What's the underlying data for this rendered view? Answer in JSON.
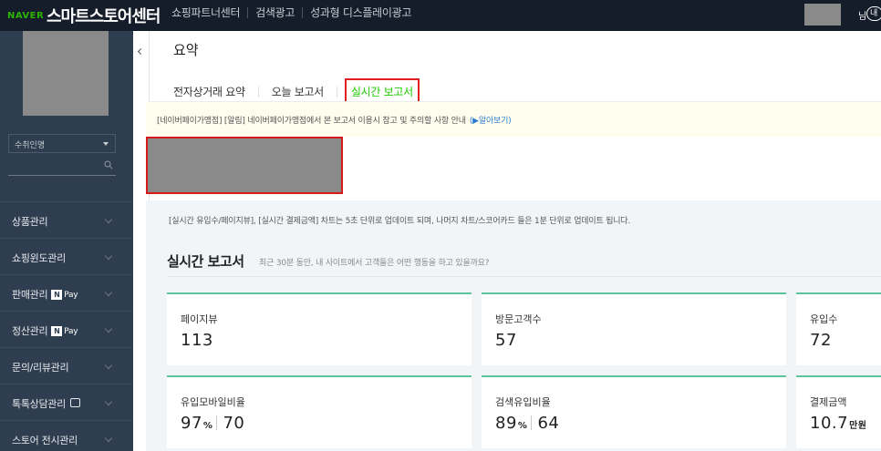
{
  "topbar": {
    "brand_naver": "NAVER",
    "brand_title": "스마트스토어센터",
    "nav": [
      "쇼핑파트너센터",
      "검색광고",
      "성과형 디스플레이광고"
    ],
    "user_suffix": "님",
    "user_badge": "내"
  },
  "sidebar": {
    "store_select": "수취인명",
    "search_placeholder": "",
    "menu": [
      {
        "label": "상품관리",
        "badge": ""
      },
      {
        "label": "쇼핑윈도관리",
        "badge": ""
      },
      {
        "label": "판매관리",
        "badge": "npay"
      },
      {
        "label": "정산관리",
        "badge": "npay"
      },
      {
        "label": "문의/리뷰관리",
        "badge": ""
      },
      {
        "label": "톡톡상담관리",
        "badge": "chat"
      },
      {
        "label": "스토어 전시관리",
        "badge": ""
      }
    ],
    "npay_n": "N",
    "npay_text": "Pay"
  },
  "main": {
    "page_title": "요약",
    "tabs": [
      "전자상거래 요약",
      "오늘 보고서",
      "실시간 보고서"
    ],
    "active_tab": 2,
    "notice": "[네이버페이가맹점] [알림] 네이버페이가맹점에서 본 보고서 이용시 참고 및 주의할 사항 안내",
    "notice_link": "(▶알아보기)",
    "info": "[실시간 유입수/페이지뷰], [실시간 결제금액] 차트는 5초 단위로 업데이트 되며, 나머지 차트/스코어카드 들은 1분 단위로 업데이트 됩니다.",
    "section_title": "실시간 보고서",
    "section_subtitle": "최근 30분 동안, 내 사이트에서 고객들은 어떤 행동을 하고 있을까요?",
    "cards": [
      {
        "label": "페이지뷰",
        "value": "113"
      },
      {
        "label": "방문고객수",
        "value": "57"
      },
      {
        "label": "유입수",
        "value": "72"
      },
      {
        "label": "유입모바일비율",
        "value": "97",
        "unit": "%",
        "extra": "70"
      },
      {
        "label": "검색유입비율",
        "value": "89",
        "unit": "%",
        "extra": "64"
      },
      {
        "label": "결제금액",
        "value": "10.7",
        "unit": "만원"
      }
    ]
  },
  "colors": {
    "topbar_bg": "#141d29",
    "sidebar_bg": "#2e3d4f",
    "naver_green": "#2db400",
    "active_tab": "#1ec800",
    "card_accent": "#5bc499"
  }
}
